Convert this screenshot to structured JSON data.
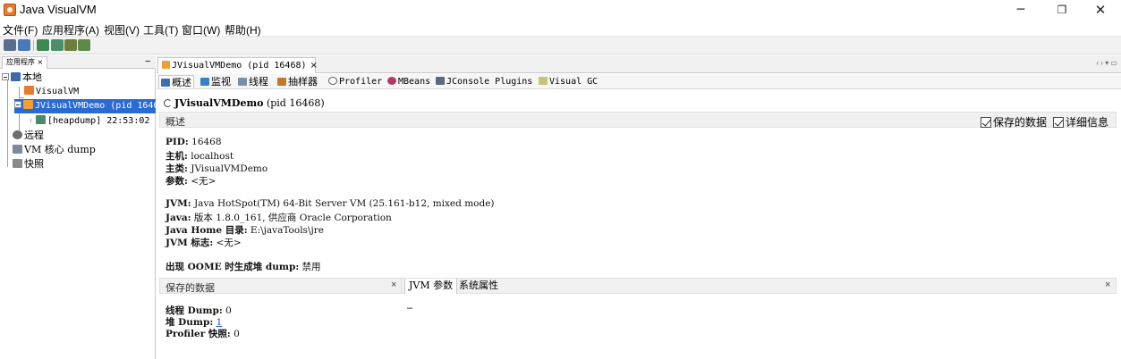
{
  "window": {
    "title": "Java VisualVM",
    "minimize_glyph": "─",
    "maximize_glyph": "❐",
    "close_glyph": "✕"
  },
  "menu": [
    "文件(F)",
    "应用程序(A)",
    "视图(V)",
    "工具(T)",
    "窗口(W)",
    "帮助(H)"
  ],
  "left_panel": {
    "tab_label": "应用程序",
    "tab_close": "×",
    "minimize": "−",
    "tree": {
      "local": "本地",
      "visualvm": "VisualVM",
      "app": "JVisualVMDemo (pid 1646",
      "heapdump": "[heapdump] 22:53:02",
      "remote": "远程",
      "core_dump": "VM 核心 dump",
      "snapshots": "快照"
    }
  },
  "doc_tab": {
    "label": "JVisualVMDemo (pid 16468)",
    "close": "×",
    "controls": "‹ › ▾ ▭"
  },
  "view_tabs": [
    "概述",
    "监视",
    "线程",
    "抽样器",
    "Profiler",
    "MBeans",
    "JConsole Plugins",
    "Visual GC"
  ],
  "header": {
    "app_name": "JVisualVMDemo",
    "pid_text": "(pid 16468)"
  },
  "overview": {
    "section_title": "概述",
    "saved_data_checkbox": "保存的数据",
    "details_checkbox": "详细信息",
    "pid_label": "PID:",
    "pid_value": "16468",
    "host_label": "主机:",
    "host_value": "localhost",
    "mainclass_label": "主类:",
    "mainclass_value": "JVisualVMDemo",
    "args_label": "参数:",
    "args_value": "<无>",
    "jvm_label": "JVM:",
    "jvm_value": "Java HotSpot(TM) 64-Bit Server VM (25.161-b12, mixed mode)",
    "java_label": "Java:",
    "java_value": "版本 1.8.0_161, 供应商 Oracle Corporation",
    "javahome_label": "Java Home 目录:",
    "javahome_value": "E:\\javaTools\\jre",
    "jvmflags_label": "JVM 标志:",
    "jvmflags_value": "<无>",
    "oome_label": "出现 OOME 时生成堆 dump:",
    "oome_value": "禁用"
  },
  "saved_data": {
    "title": "保存的数据",
    "close": "×",
    "thread_dump_label": "线程 Dump:",
    "thread_dump_value": "0",
    "heap_dump_label": "堆 Dump:",
    "heap_dump_value": "1",
    "profiler_label": "Profiler 快照:",
    "profiler_value": "0"
  },
  "props_panel": {
    "tab_jvm_args": "JVM 参数",
    "tab_system_props": "系统属性",
    "close": "×",
    "placeholder": "–"
  }
}
